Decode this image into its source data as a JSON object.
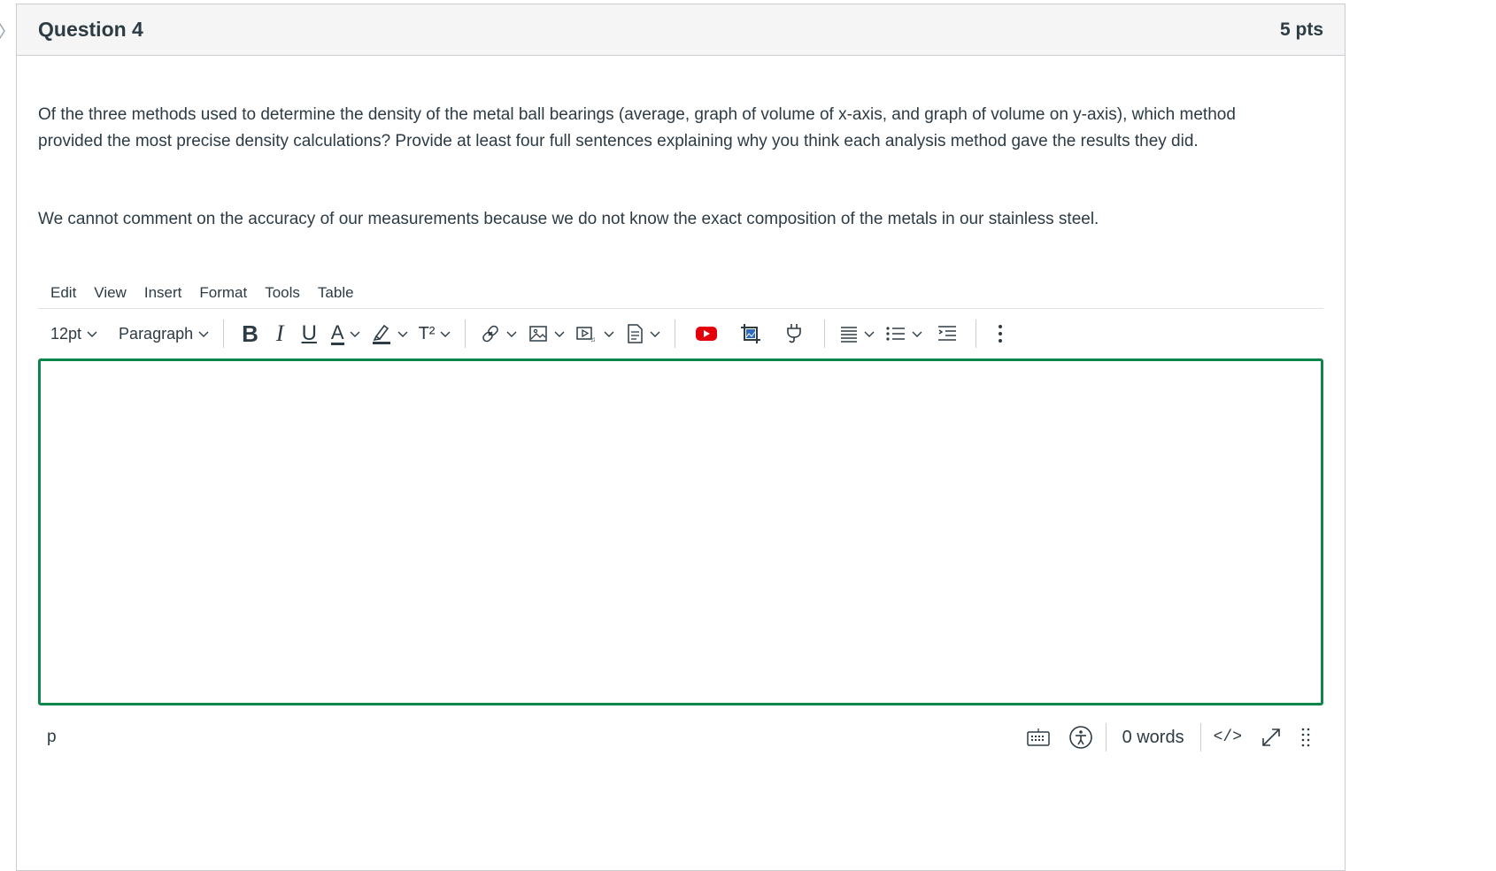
{
  "question": {
    "title": "Question 4",
    "points": "5 pts",
    "prompt": "Of the three methods used to determine the density of the metal ball bearings (average, graph of volume of x-axis, and graph of volume on y-axis), which method provided the most precise density calculations? Provide at least four full sentences explaining why you think each analysis method gave the results they did.",
    "note": "We cannot comment on the accuracy of our measurements because we do not know the exact composition of the metals in our stainless steel."
  },
  "editor": {
    "menubar": [
      "Edit",
      "View",
      "Insert",
      "Format",
      "Tools",
      "Table"
    ],
    "font_size": "12pt",
    "block_format": "Paragraph",
    "accent_color": "#0b874b",
    "icons": {
      "bold": "B",
      "italic": "I",
      "underline": "U",
      "text_color": "A",
      "superscript": "T²"
    },
    "content": "",
    "status": {
      "path": "p",
      "word_count": "0 words",
      "html_toggle": "</>"
    }
  },
  "colors": {
    "youtube_red": "#e3000b",
    "text": "#2d3b45",
    "border": "#c7cdd1"
  }
}
